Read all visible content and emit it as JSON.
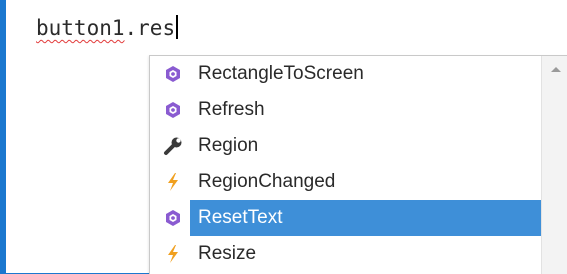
{
  "editor": {
    "code_object": "button1",
    "code_rest": ".res"
  },
  "intellisense": {
    "items": [
      {
        "label": "RectangleToScreen",
        "icon": "method-icon"
      },
      {
        "label": "Refresh",
        "icon": "method-icon"
      },
      {
        "label": "Region",
        "icon": "property-wrench-icon"
      },
      {
        "label": "RegionChanged",
        "icon": "event-lightning-icon"
      },
      {
        "label": "ResetText",
        "icon": "method-icon",
        "selected": true
      },
      {
        "label": "Resize",
        "icon": "event-lightning-icon"
      }
    ]
  },
  "colors": {
    "window_border": "#1b78cf",
    "selection": "#3e8fd8",
    "method_icon": "#8a5bd1",
    "event_icon": "#f0a020",
    "squiggle": "#e23b3b"
  }
}
